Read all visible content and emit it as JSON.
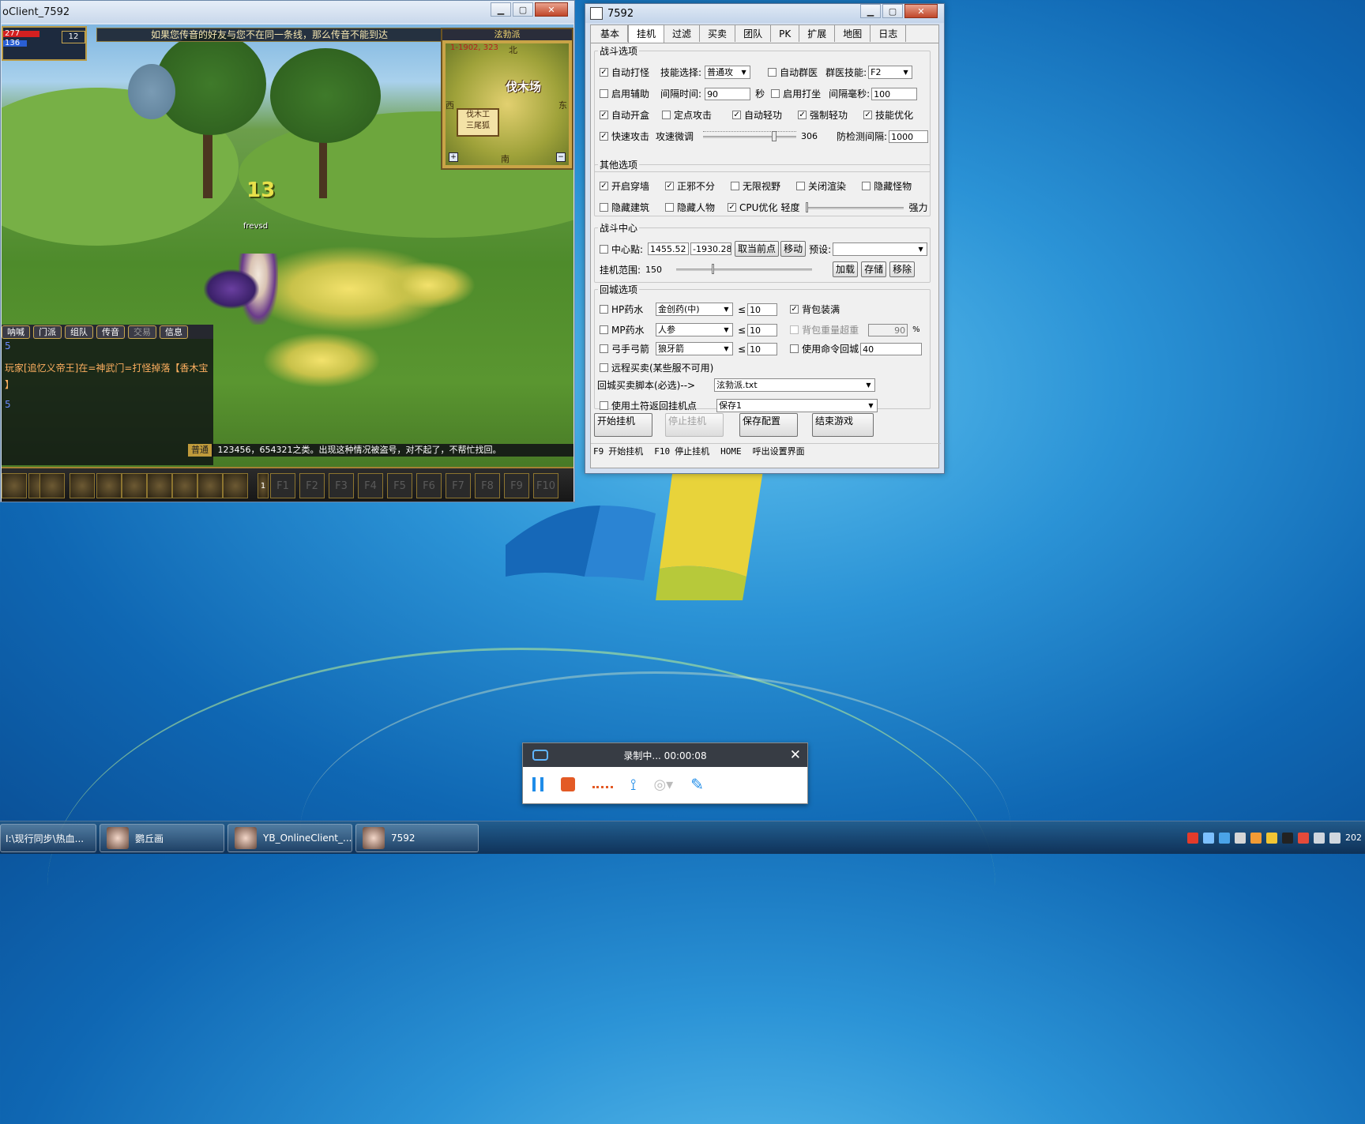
{
  "game_window": {
    "title": "oClient_7592",
    "hp_text": "277",
    "mp_text": "136",
    "level": "12",
    "top_message": "如果您传音的好友与您不在同一条线，那么传音不能到达",
    "minimap": {
      "title": "泫勃派",
      "coords": "1-1902, 323",
      "north": "北",
      "west": "西",
      "east": "东",
      "south": "南",
      "area": "伐木场",
      "sign": "伐木工\n三尾狐"
    },
    "damage_number": "13",
    "player_name": "frevsd",
    "chat_tabs": [
      "呐喊",
      "门派",
      "组队",
      "传音",
      "交易",
      "信息"
    ],
    "chat_lines": [
      "5",
      "玩家[追忆义帝王]在=神武门=打怪掉落【香木宝",
      "】",
      "5"
    ],
    "bottom_channel": "普通",
    "bottom_message": "123456，654321之类。出现这种情况被盗号，对不起了，不帮忙找回。",
    "skill_page": "1",
    "fkeys": [
      "F1",
      "F2",
      "F3",
      "F4",
      "F5",
      "F6",
      "F7",
      "F8",
      "F9",
      "F10"
    ]
  },
  "config_window": {
    "title": "7592",
    "tabs": [
      "基本",
      "挂机",
      "过滤",
      "买卖",
      "团队",
      "PK",
      "扩展",
      "地图",
      "日志"
    ],
    "active_tab": "挂机",
    "combat": {
      "legend": "战斗选项",
      "auto_attack": "自动打怪",
      "auto_attack_checked": true,
      "skill_select_label": "技能选择:",
      "skill_select_value": "普通攻",
      "auto_group_heal": "自动群医",
      "auto_group_heal_checked": false,
      "group_heal_skill_label": "群医技能:",
      "group_heal_skill_value": "F2",
      "enable_assist": "启用辅助",
      "enable_assist_checked": false,
      "interval_label": "间隔时间:",
      "interval_value": "90",
      "interval_unit": "秒",
      "enable_meditate": "启用打坐",
      "enable_meditate_checked": false,
      "interval_ms_label": "间隔毫秒:",
      "interval_ms_value": "100",
      "auto_open_box": "自动开盒",
      "auto_open_box_checked": true,
      "fixed_attack": "定点攻击",
      "fixed_attack_checked": false,
      "auto_qinggong": "自动轻功",
      "auto_qinggong_checked": true,
      "force_qinggong": "强制轻功",
      "force_qinggong_checked": true,
      "skill_optimize": "技能优化",
      "skill_optimize_checked": true,
      "fast_attack": "快速攻击",
      "fast_attack_checked": true,
      "attack_speed_label": "攻速微调",
      "attack_speed_value": "306",
      "attack_speed_fraction": 0.78,
      "anti_detect_label": "防检测间隔:",
      "anti_detect_value": "1000"
    },
    "other": {
      "legend": "其他选项",
      "wall_pass": "开启穿墙",
      "wall_pass_checked": true,
      "no_faction": "正邪不分",
      "no_faction_checked": true,
      "unlimited_view": "无限视野",
      "unlimited_view_checked": false,
      "disable_render": "关闭渲染",
      "disable_render_checked": false,
      "hide_monsters": "隐藏怪物",
      "hide_monsters_checked": false,
      "hide_buildings": "隐藏建筑",
      "hide_buildings_checked": false,
      "hide_players": "隐藏人物",
      "hide_players_checked": false,
      "cpu_optimize": "CPU优化",
      "cpu_optimize_checked": true,
      "cpu_light": "轻度",
      "cpu_strong": "强力",
      "cpu_level_fraction": 0.0
    },
    "center": {
      "legend": "战斗中心",
      "center_point": "中心點:",
      "center_point_checked": false,
      "x_value": "1455.52",
      "y_value": "-1930.28",
      "cancel_btn": "取当前点",
      "move_btn": "移动",
      "preset_label": "预设:",
      "preset_value": "",
      "range_label": "挂机范围:",
      "range_value": "150",
      "range_fraction": 0.27,
      "load_btn": "加载",
      "save_btn": "存储",
      "remove_btn": "移除"
    },
    "return": {
      "legend": "回城选项",
      "hp_potion": "HP药水",
      "hp_potion_checked": false,
      "hp_potion_value": "金创药(中)",
      "hp_threshold": "10",
      "bag_full": "背包装满",
      "bag_full_checked": true,
      "mp_potion": "MP药水",
      "mp_potion_checked": false,
      "mp_potion_value": "人参",
      "mp_threshold": "10",
      "bag_weight": "背包重量超重",
      "bag_weight_value": "90",
      "bag_weight_unit": "%",
      "arrows": "弓手弓箭",
      "arrows_checked": false,
      "arrows_value": "狼牙箭",
      "arrows_threshold": "10",
      "use_cmd_return": "使用命令回城",
      "use_cmd_return_checked": false,
      "cmd_value": "40",
      "le_symbol": "≤",
      "remote_trade": "远程买卖(某些服不可用)",
      "remote_trade_checked": false,
      "script_label": "回城买卖脚本(必选)-->",
      "script_value": "泫勃派.txt",
      "use_talisman": "使用土符返回挂机点",
      "use_talisman_checked": false,
      "talisman_value": "保存1"
    },
    "buttons": {
      "start": "开始挂机",
      "stop": "停止挂机",
      "save": "保存配置",
      "end": "结束游戏"
    },
    "hotkeys": [
      "F9",
      "开始挂机",
      "F10",
      "停止挂机",
      "HOME",
      "呼出设置界面"
    ]
  },
  "recorder": {
    "status": "录制中... 00:00:08"
  },
  "taskbar": {
    "items": [
      "I:\\现行同步\\热血...",
      "鹦丘画",
      "YB_OnlineClient_...",
      "7592"
    ],
    "clock": "202"
  }
}
